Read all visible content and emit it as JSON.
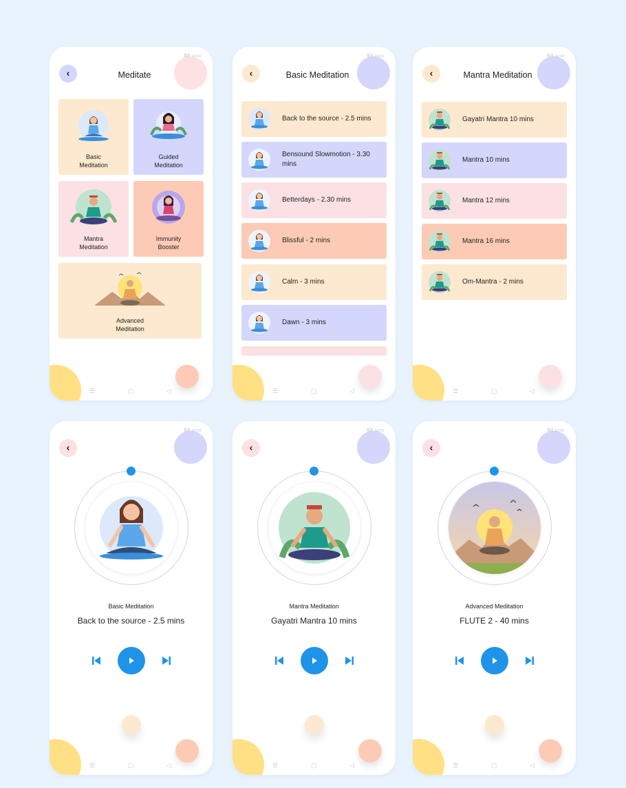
{
  "colors": {
    "background": "#e9f3fd",
    "tile_yellow": "#fde9cf",
    "tile_lavender": "#d5d6fb",
    "tile_pink": "#fbe1e3",
    "tile_peach": "#fdcbb5",
    "accent_blue": "#1f93e8",
    "blob_yellow": "#ffe085"
  },
  "status_bar": "Sil ▭▭",
  "meditate": {
    "title": "Meditate",
    "tiles": [
      {
        "label": "Basic\nMeditation"
      },
      {
        "label": "Guided\nMeditation"
      },
      {
        "label": "Mantra\nMeditation"
      },
      {
        "label": "Immunity\nBooster"
      },
      {
        "label": "Advanced\nMeditation"
      }
    ]
  },
  "basic": {
    "title": "Basic Meditation",
    "items": [
      "Back to the source - 2.5 mins",
      "Bensound Slowmotion - 3.30 mins",
      "Betterdays - 2.30 mins",
      "Blissful - 2 mins",
      "Calm - 3 mins",
      "Dawn - 3 mins"
    ]
  },
  "mantra": {
    "title": "Mantra Meditation",
    "items": [
      "Gayatri Mantra 10 mins",
      "Mantra 10 mins",
      "Mantra 12 mins",
      "Mantra 16 mins",
      "Om-Mantra - 2 mins"
    ]
  },
  "players": [
    {
      "category": "Basic Meditation",
      "track": "Back to the source - 2.5 mins"
    },
    {
      "category": "Mantra Meditation",
      "track": "Gayatri Mantra 10 mins"
    },
    {
      "category": "Advanced Meditation",
      "track": "FLUTE 2 - 40 mins"
    }
  ],
  "icons": {
    "back": "chevron-left-icon",
    "play": "play-icon",
    "prev": "skip-previous-icon",
    "next": "skip-next-icon",
    "nav_menu": "menu-icon",
    "nav_home": "square-icon",
    "nav_back": "triangle-back-icon"
  }
}
